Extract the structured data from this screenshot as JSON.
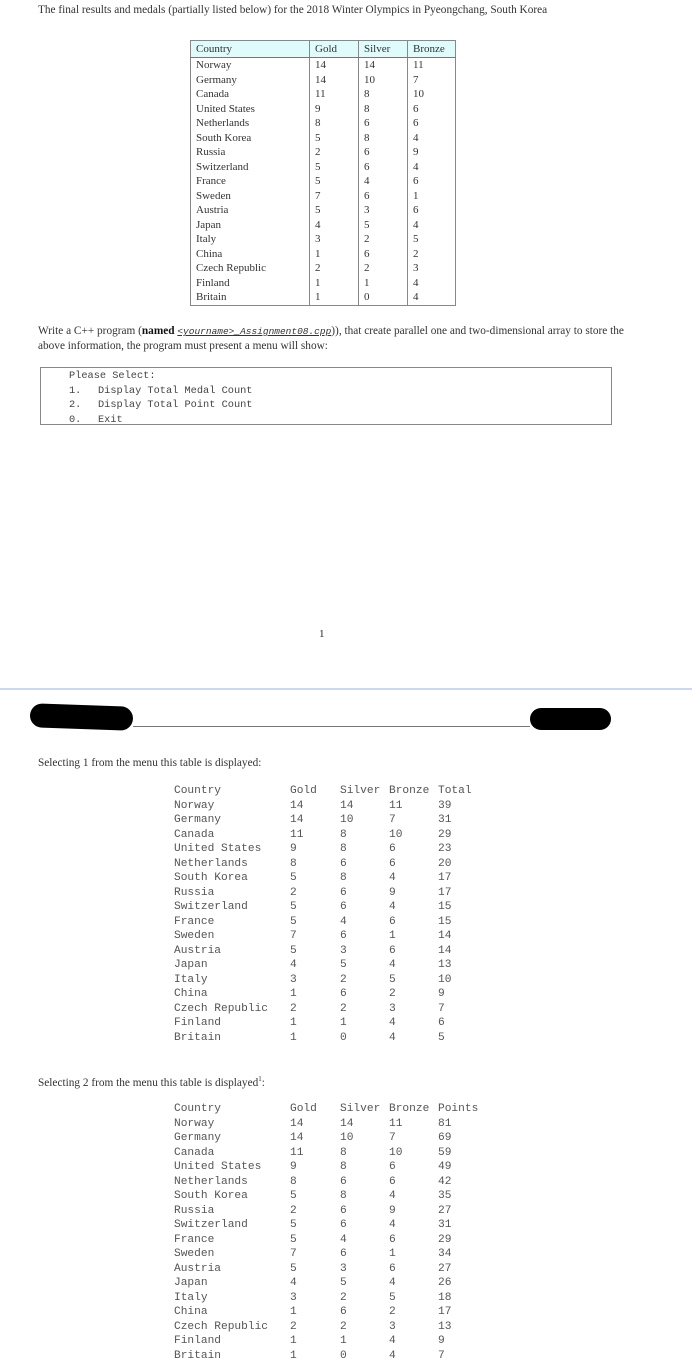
{
  "intro": "The final results and medals (partially listed below) for the 2018 Winter Olympics in Pyeongchang, South Korea",
  "medal_table": {
    "headers": [
      "Country",
      "Gold",
      "Silver",
      "Bronze"
    ],
    "rows": [
      [
        "Norway",
        "14",
        "14",
        "11"
      ],
      [
        "Germany",
        "14",
        "10",
        "7"
      ],
      [
        "Canada",
        "11",
        "8",
        "10"
      ],
      [
        "United States",
        "9",
        "8",
        "6"
      ],
      [
        "Netherlands",
        "8",
        "6",
        "6"
      ],
      [
        "South Korea",
        "5",
        "8",
        "4"
      ],
      [
        "Russia",
        "2",
        "6",
        "9"
      ],
      [
        "Switzerland",
        "5",
        "6",
        "4"
      ],
      [
        "France",
        "5",
        "4",
        "6"
      ],
      [
        "Sweden",
        "7",
        "6",
        "1"
      ],
      [
        "Austria",
        "5",
        "3",
        "6"
      ],
      [
        "Japan",
        "4",
        "5",
        "4"
      ],
      [
        "Italy",
        "3",
        "2",
        "5"
      ],
      [
        "China",
        "1",
        "6",
        "2"
      ],
      [
        "Czech Republic",
        "2",
        "2",
        "3"
      ],
      [
        "Finland",
        "1",
        "1",
        "4"
      ],
      [
        "Britain",
        "1",
        "0",
        "4"
      ]
    ],
    "header_color": "#e0fbfc"
  },
  "assignment": {
    "prefix": "Write a C++ program (",
    "named_label": "named",
    "filename": "<yourname>_Assignment08.cpp",
    "suffix": ")), that create parallel one and two-dimensional array to store the above information, the program must present a menu will show:"
  },
  "menu": {
    "title": "Please Select:",
    "options": [
      {
        "num": "1.",
        "label": "Display Total Medal Count"
      },
      {
        "num": "2.",
        "label": "Display Total Point Count"
      },
      {
        "num": "0.",
        "label": "Exit"
      }
    ]
  },
  "page_number": "1",
  "output1": {
    "caption": "Selecting 1 from the menu this table is displayed:",
    "headers": [
      "Country",
      "Gold",
      "Silver",
      "Bronze",
      "Total"
    ],
    "rows": [
      [
        "Norway",
        "14",
        "14",
        "11",
        "39"
      ],
      [
        "Germany",
        "14",
        "10",
        "7",
        "31"
      ],
      [
        "Canada",
        "11",
        "8",
        "10",
        "29"
      ],
      [
        "United States",
        "9",
        "8",
        "6",
        "23"
      ],
      [
        "Netherlands",
        "8",
        "6",
        "6",
        "20"
      ],
      [
        "South Korea",
        "5",
        "8",
        "4",
        "17"
      ],
      [
        "Russia",
        "2",
        "6",
        "9",
        "17"
      ],
      [
        "Switzerland",
        "5",
        "6",
        "4",
        "15"
      ],
      [
        "France",
        "5",
        "4",
        "6",
        "15"
      ],
      [
        "Sweden",
        "7",
        "6",
        "1",
        "14"
      ],
      [
        "Austria",
        "5",
        "3",
        "6",
        "14"
      ],
      [
        "Japan",
        "4",
        "5",
        "4",
        "13"
      ],
      [
        "Italy",
        "3",
        "2",
        "5",
        "10"
      ],
      [
        "China",
        "1",
        "6",
        "2",
        "9"
      ],
      [
        "Czech Republic",
        "2",
        "2",
        "3",
        "7"
      ],
      [
        "Finland",
        "1",
        "1",
        "4",
        "6"
      ],
      [
        "Britain",
        "1",
        "0",
        "4",
        "5"
      ]
    ]
  },
  "output2": {
    "caption": "Selecting 2 from the menu this table is displayed",
    "footnote_mark": "1",
    "caption_end": ":",
    "headers": [
      "Country",
      "Gold",
      "Silver",
      "Bronze",
      "Points"
    ],
    "rows": [
      [
        "Norway",
        "14",
        "14",
        "11",
        "81"
      ],
      [
        "Germany",
        "14",
        "10",
        "7",
        "69"
      ],
      [
        "Canada",
        "11",
        "8",
        "10",
        "59"
      ],
      [
        "United States",
        "9",
        "8",
        "6",
        "49"
      ],
      [
        "Netherlands",
        "8",
        "6",
        "6",
        "42"
      ],
      [
        "South Korea",
        "5",
        "8",
        "4",
        "35"
      ],
      [
        "Russia",
        "2",
        "6",
        "9",
        "27"
      ],
      [
        "Switzerland",
        "5",
        "6",
        "4",
        "31"
      ],
      [
        "France",
        "5",
        "4",
        "6",
        "29"
      ],
      [
        "Sweden",
        "7",
        "6",
        "1",
        "34"
      ],
      [
        "Austria",
        "5",
        "3",
        "6",
        "27"
      ],
      [
        "Japan",
        "4",
        "5",
        "4",
        "26"
      ],
      [
        "Italy",
        "3",
        "2",
        "5",
        "18"
      ],
      [
        "China",
        "1",
        "6",
        "2",
        "17"
      ],
      [
        "Czech Republic",
        "2",
        "2",
        "3",
        "13"
      ],
      [
        "Finland",
        "1",
        "1",
        "4",
        "9"
      ],
      [
        "Britain",
        "1",
        "0",
        "4",
        "7"
      ]
    ]
  }
}
